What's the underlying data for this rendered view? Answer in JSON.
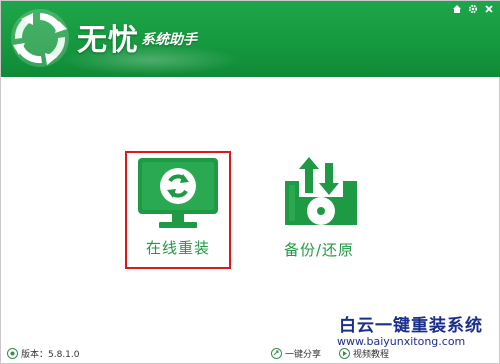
{
  "app": {
    "title": "无忧",
    "subtitle": "系统助手"
  },
  "window_controls": [
    {
      "icon": "home-icon"
    },
    {
      "icon": "gear-icon"
    },
    {
      "icon": "close-icon"
    }
  ],
  "tiles": {
    "reinstall": {
      "label": "在线重装",
      "icon": "monitor-refresh-icon",
      "selected": true
    },
    "backup": {
      "label": "备份/还原",
      "icon": "disk-backup-icon"
    }
  },
  "watermark": {
    "text": "白云一键重装系统",
    "url": "www.baiyunxitong.com"
  },
  "status_bar": {
    "version": "版本：5.8.1.0",
    "share": "一键分享",
    "video": "视频教程"
  },
  "colors": {
    "header": "#1a9e45",
    "accent": "#219a46",
    "highlight_border": "#e0161b",
    "watermark": "#1a2f8c"
  }
}
